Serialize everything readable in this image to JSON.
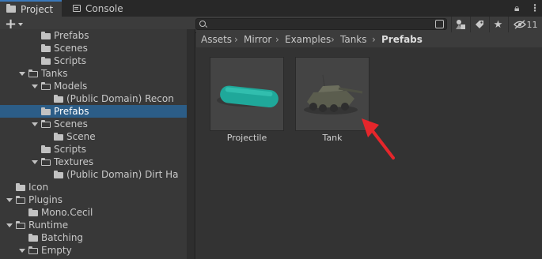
{
  "tabs": [
    {
      "label": "Project",
      "icon": "folder-icon",
      "active": true
    },
    {
      "label": "Console",
      "icon": "console-icon",
      "active": false
    }
  ],
  "window_controls": {
    "lock_icon": "lock-icon",
    "menu_icon": "more-vertical-icon"
  },
  "toolbar": {
    "create_label": "+",
    "search": {
      "value": "",
      "placeholder": ""
    },
    "hidden_count": "11"
  },
  "tree": [
    {
      "label": "Prefabs",
      "depth": 4,
      "expanded": null,
      "selected": false
    },
    {
      "label": "Scenes",
      "depth": 4,
      "expanded": null,
      "selected": false
    },
    {
      "label": "Scripts",
      "depth": 4,
      "expanded": null,
      "selected": false
    },
    {
      "label": "Tanks",
      "depth": 3,
      "expanded": true,
      "selected": false
    },
    {
      "label": "Models",
      "depth": 4,
      "expanded": true,
      "selected": false
    },
    {
      "label": "(Public Domain) Recon",
      "depth": 5,
      "expanded": null,
      "selected": false
    },
    {
      "label": "Prefabs",
      "depth": 4,
      "expanded": null,
      "selected": true
    },
    {
      "label": "Scenes",
      "depth": 4,
      "expanded": true,
      "selected": false
    },
    {
      "label": "Scene",
      "depth": 5,
      "expanded": null,
      "selected": false
    },
    {
      "label": "Scripts",
      "depth": 4,
      "expanded": null,
      "selected": false
    },
    {
      "label": "Textures",
      "depth": 4,
      "expanded": true,
      "selected": false
    },
    {
      "label": "(Public Domain) Dirt Ha",
      "depth": 5,
      "expanded": null,
      "selected": false
    },
    {
      "label": "Icon",
      "depth": 2,
      "expanded": null,
      "selected": false
    },
    {
      "label": "Plugins",
      "depth": 2,
      "expanded": true,
      "selected": false
    },
    {
      "label": "Mono.Cecil",
      "depth": 3,
      "expanded": null,
      "selected": false
    },
    {
      "label": "Runtime",
      "depth": 2,
      "expanded": true,
      "selected": false
    },
    {
      "label": "Batching",
      "depth": 3,
      "expanded": null,
      "selected": false
    },
    {
      "label": "Empty",
      "depth": 3,
      "expanded": true,
      "selected": false
    }
  ],
  "breadcrumb": [
    "Assets",
    "Mirror",
    "Examples",
    "Tanks",
    "Prefabs"
  ],
  "assets": [
    {
      "name": "Projectile",
      "thumbnail": "projectile-capsule"
    },
    {
      "name": "Tank",
      "thumbnail": "tank-model"
    }
  ],
  "colors": {
    "selection": "#2c5d87",
    "tab_accent": "#3a79bb",
    "projectile": "#1fa89a",
    "pointer_arrow": "#e5262b"
  }
}
